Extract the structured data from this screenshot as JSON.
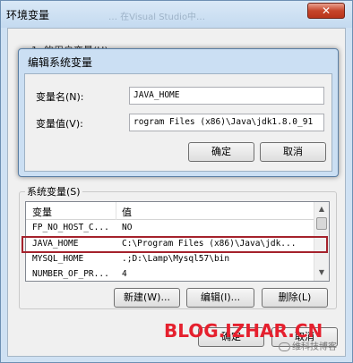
{
  "outer": {
    "title": "环境变量",
    "faded_title": "… 在Visual Studio中…",
    "close_glyph": "✕",
    "user_vars_label": "1. 的用户变量(U)",
    "sys_vars_label": "系统变量(S)",
    "list": {
      "columns": [
        "变量",
        "值"
      ],
      "rows": [
        {
          "name": "FP_NO_HOST_C...",
          "value": "NO"
        },
        {
          "name": "JAVA_HOME",
          "value": "C:\\Program Files (x86)\\Java\\jdk..."
        },
        {
          "name": "MYSQL_HOME",
          "value": ".;D:\\Lamp\\Mysql57\\bin"
        },
        {
          "name": "NUMBER_OF_PR...",
          "value": "4"
        }
      ],
      "selected_index": 1
    },
    "buttons": {
      "new": "新建(W)...",
      "edit": "编辑(I)...",
      "delete": "删除(L)",
      "ok": "确定",
      "cancel": "取消"
    },
    "watermark": "BLOG.IZHAR.CN",
    "wechat_mark": "维科技博客"
  },
  "dialog": {
    "title": "编辑系统变量",
    "name_label": "变量名(N):",
    "value_label": "变量值(V):",
    "name_value": "JAVA_HOME",
    "value_value": "rogram Files (x86)\\Java\\jdk1.8.0_91",
    "ok": "确定",
    "cancel": "取消"
  },
  "colors": {
    "highlight_border": "#a5222c",
    "watermark": "#e5202e",
    "titlebar": "#cfe1f3"
  }
}
